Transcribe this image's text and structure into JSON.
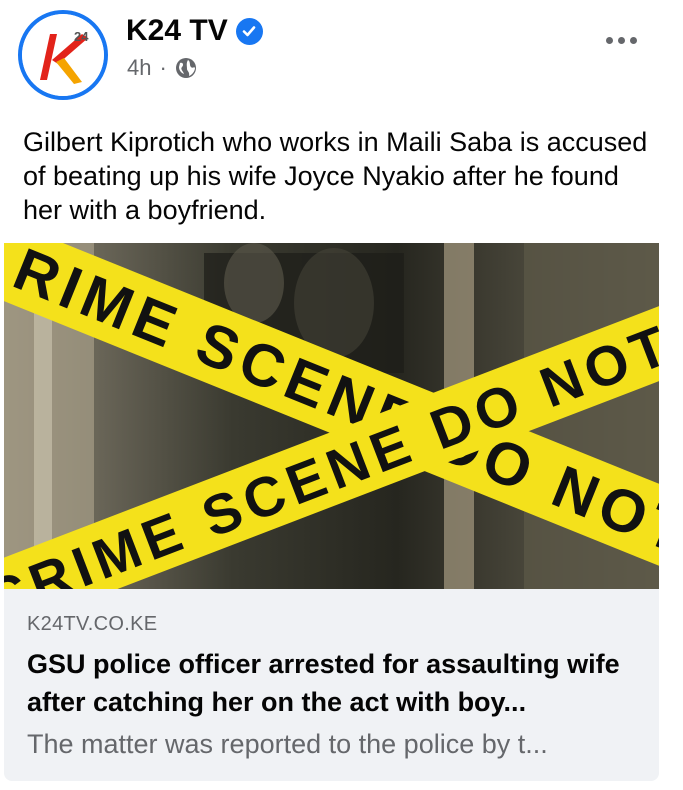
{
  "post": {
    "page_name": "K24 TV",
    "time": "4h",
    "separator": "·",
    "caption": "Gilbert Kiprotich who works in Maili Saba is accused of beating up his wife Joyce Nyakio after he found her with a boyfriend."
  },
  "logo": {
    "text": "24"
  },
  "tape": {
    "upper": "RIME SCENE DO NOT CR",
    "lower": "CRIME SCENE DO NOT CR"
  },
  "link": {
    "domain": "K24TV.CO.KE",
    "title": "GSU police officer arrested for assaulting wife after catching her on the act with boy...",
    "description": "The matter was reported to the police by t..."
  },
  "colors": {
    "brand_blue": "#1877f2",
    "tape_yellow": "#f4e11b",
    "card_bg": "#f0f2f5",
    "secondary_text": "#65676b"
  },
  "icons": [
    "verified-badge-icon",
    "globe-icon",
    "more-options-icon",
    "k24-logo-icon"
  ]
}
